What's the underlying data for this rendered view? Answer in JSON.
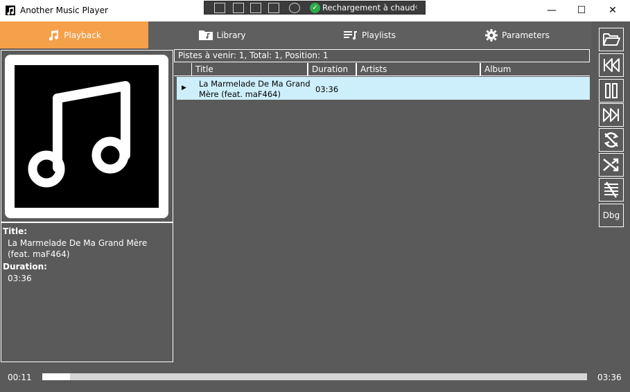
{
  "window": {
    "title": "Another Music Player",
    "controls": {
      "minimize": "—",
      "maximize": "☐",
      "close": "✕"
    }
  },
  "devbar": {
    "hot_reload_label": "Rechargement à chaud",
    "hot_reload_check": "✓",
    "collapse": "‹"
  },
  "tabs": [
    {
      "label": "Playback",
      "icon": "music-note-icon",
      "active": true
    },
    {
      "label": "Library",
      "icon": "folder-music-icon",
      "active": false
    },
    {
      "label": "Playlists",
      "icon": "playlist-icon",
      "active": false
    },
    {
      "label": "Parameters",
      "icon": "gear-icon",
      "active": false
    }
  ],
  "now_playing": {
    "title_label": "Title:",
    "title_value": "La Marmelade De Ma Grand Mère (feat. maF464)",
    "duration_label": "Duration:",
    "duration_value": "03:36"
  },
  "queue": {
    "status": "Pistes à venir:  1, Total:  1, Position: 1",
    "columns": [
      "Title",
      "Duration",
      "Artists",
      "Album"
    ],
    "rows": [
      {
        "playing_marker": "▶",
        "title": "La Marmelade De Ma Grand Mère (feat. maF464)",
        "duration": "03:36",
        "artists": "",
        "album": ""
      }
    ]
  },
  "controls": {
    "icons": [
      "open-folder-icon",
      "previous-icon",
      "pause-icon",
      "next-icon",
      "repeat-off-icon",
      "shuffle-icon",
      "clear-queue-icon"
    ],
    "dbg_label": "Dbg"
  },
  "progress": {
    "elapsed": "00:11",
    "total": "03:36",
    "fraction": 0.051
  },
  "colors": {
    "accent": "#f5a04a",
    "background": "#5a5a5a",
    "tab_inactive": "#5f5f5f",
    "selected_row": "#cdeffc"
  }
}
